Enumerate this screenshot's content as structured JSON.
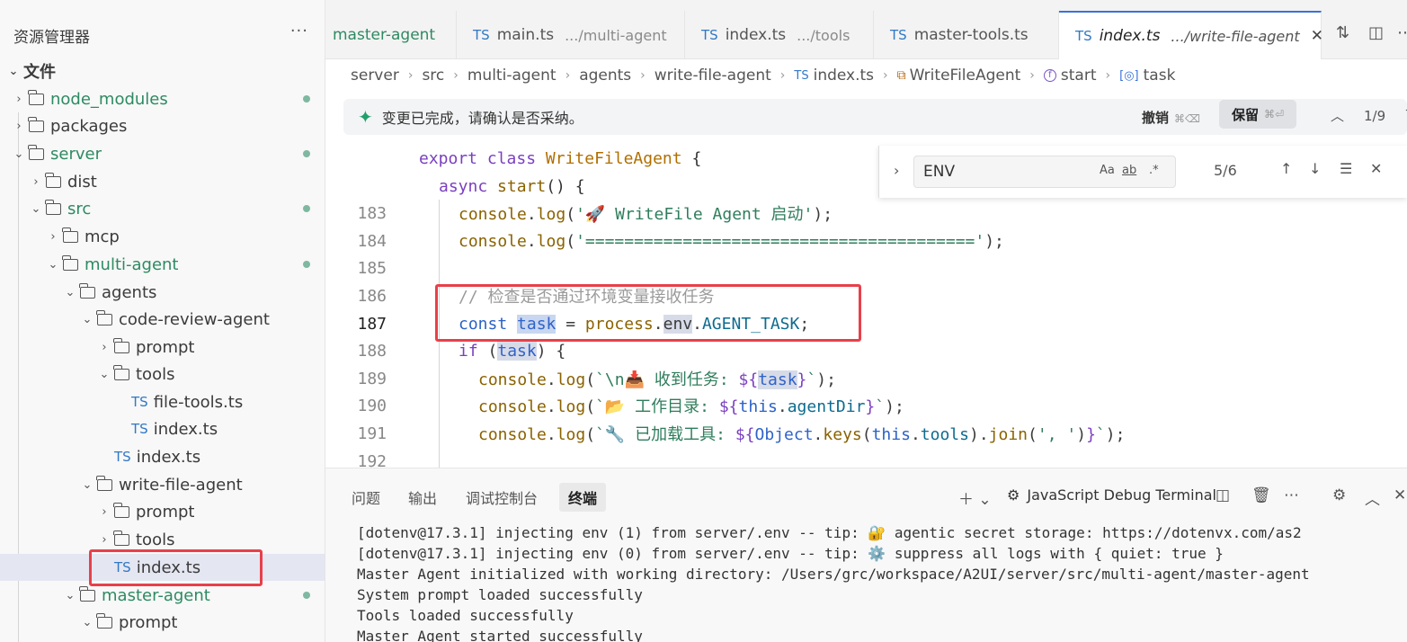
{
  "sidebar": {
    "title": "资源管理器",
    "more": "···",
    "rows": [
      {
        "label": "文件",
        "type": "root"
      },
      {
        "label": "node_modules",
        "type": "folder"
      },
      {
        "label": "packages",
        "type": "folder"
      },
      {
        "label": "server",
        "type": "folder"
      },
      {
        "label": "dist",
        "type": "folder"
      },
      {
        "label": "src",
        "type": "folder"
      },
      {
        "label": "mcp",
        "type": "folder"
      },
      {
        "label": "multi-agent",
        "type": "folder"
      },
      {
        "label": "agents",
        "type": "folder"
      },
      {
        "label": "code-review-agent",
        "type": "folder"
      },
      {
        "label": "prompt",
        "type": "folder"
      },
      {
        "label": "tools",
        "type": "folder"
      },
      {
        "label": "file-tools.ts",
        "type": "ts"
      },
      {
        "label": "index.ts",
        "type": "ts"
      },
      {
        "label": "index.ts",
        "type": "ts"
      },
      {
        "label": "write-file-agent",
        "type": "folder"
      },
      {
        "label": "prompt",
        "type": "folder"
      },
      {
        "label": "tools",
        "type": "folder"
      },
      {
        "label": "index.ts",
        "type": "ts"
      },
      {
        "label": "master-agent",
        "type": "folder"
      },
      {
        "label": "prompt",
        "type": "folder"
      }
    ],
    "ts_badge": "TS"
  },
  "tabs": [
    {
      "name": "master-agent",
      "path": ""
    },
    {
      "name": "main.ts",
      "path": ".../multi-agent"
    },
    {
      "name": "index.ts",
      "path": ".../tools"
    },
    {
      "name": "master-tools.ts",
      "path": ""
    },
    {
      "name": "index.ts",
      "path": ".../write-file-agent"
    }
  ],
  "breadcrumb": [
    "server",
    "src",
    "multi-agent",
    "agents",
    "write-file-agent",
    "index.ts",
    "WriteFileAgent",
    "start",
    "task"
  ],
  "accept_bar": {
    "message": "变更已完成，请确认是否采纳。",
    "undo_label": "撤销",
    "undo_shortcut": "⌘⌫",
    "keep_label": "保留",
    "keep_shortcut": "⌘⏎",
    "counter": "1/9"
  },
  "find": {
    "query": "ENV",
    "match_case": "Aa",
    "whole_word": "ab",
    "regex": ".*",
    "count": "5/6"
  },
  "code": {
    "sticky1": "export class WriteFileAgent {",
    "sticky2": "async start() {",
    "lines": [
      {
        "n": "183",
        "text": "console.log('🚀 WriteFile Agent 启动');"
      },
      {
        "n": "184",
        "text": "console.log('========================================');"
      },
      {
        "n": "185",
        "text": ""
      },
      {
        "n": "186",
        "text": "// 检查是否通过环境变量接收任务"
      },
      {
        "n": "187",
        "text": "const task = process.env.AGENT_TASK;"
      },
      {
        "n": "188",
        "text": "if (task) {"
      },
      {
        "n": "189",
        "text": "console.log(`\\n📥 收到任务: ${task}`);"
      },
      {
        "n": "190",
        "text": "console.log(`📂 工作目录: ${this.agentDir}`);"
      },
      {
        "n": "191",
        "text": "console.log(`🔧 已加载工具: ${Object.keys(this.tools).join(', ')}`);"
      },
      {
        "n": "192",
        "text": ""
      }
    ]
  },
  "panel": {
    "tabs": [
      "问题",
      "输出",
      "调试控制台",
      "终端"
    ],
    "active_tab": "终端",
    "terminal_name": "JavaScript Debug Terminal",
    "lines": [
      "[dotenv@17.3.1] injecting env (1) from server/.env -- tip: 🔐 agentic secret storage: https://dotenvx.com/as2",
      "[dotenv@17.3.1] injecting env (0) from server/.env -- tip: ⚙️ suppress all logs with { quiet: true }",
      "Master Agent initialized with working directory: /Users/grc/workspace/A2UI/server/src/multi-agent/master-agent",
      "System prompt loaded successfully",
      "Tools loaded successfully",
      "Master Agent started successfully"
    ]
  },
  "colors": {
    "accent": "#3a72d9",
    "highlight_box": "#e8404a",
    "ts_blue": "#3178c6"
  }
}
